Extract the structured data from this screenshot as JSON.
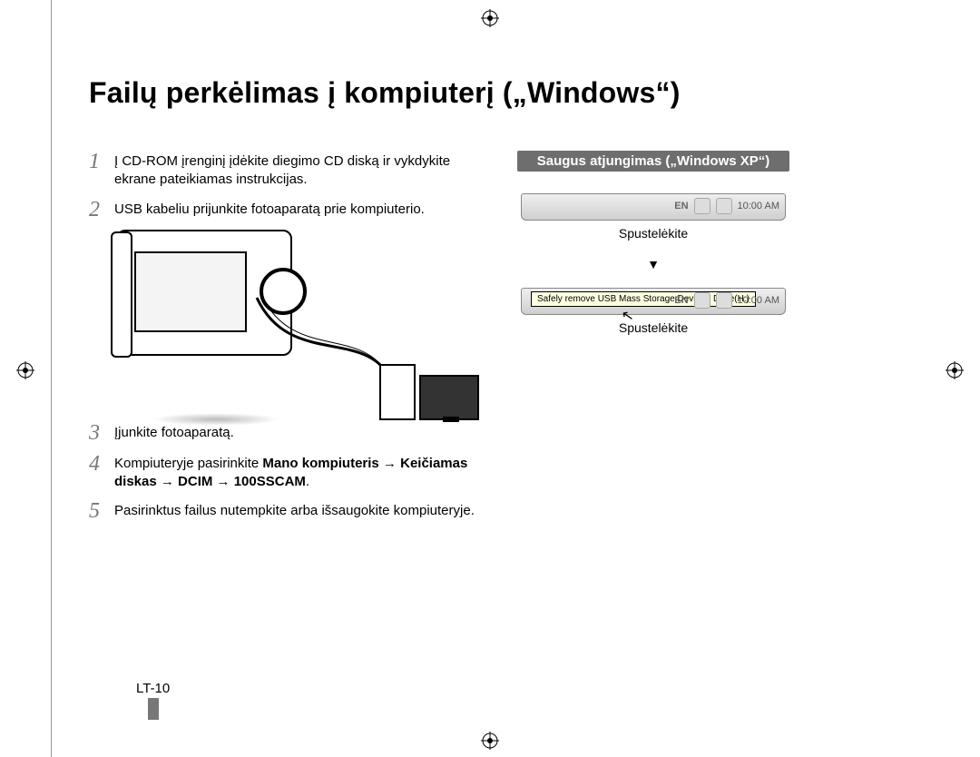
{
  "title": "Failų perkėlimas į kompiuterį („Windows“)",
  "steps": {
    "s1": {
      "n": "1",
      "t": "Į CD-ROM įrenginį įdėkite diegimo CD diską ir vykdykite ekrane pateikiamas instrukcijas."
    },
    "s2": {
      "n": "2",
      "t": "USB kabeliu prijunkite fotoaparatą prie kompiuterio."
    },
    "s3": {
      "n": "3",
      "t": "Įjunkite fotoaparatą."
    },
    "s4": {
      "n": "4",
      "pre": "Kompiuteryje pasirinkite ",
      "b1": "Mano kompiuteris",
      "arrow": " → ",
      "b2": "Keičiamas diskas",
      "b3": "DCIM",
      "b4": "100SSCAM",
      "dot": "."
    },
    "s5": {
      "n": "5",
      "t": "Pasirinktus failus nutempkite arba išsaugokite kompiuteryje."
    }
  },
  "right": {
    "header": "Saugus atjungimas („Windows XP“)",
    "click": "Spustelėkite",
    "down_arrow": "▼",
    "tooltip": "Safely remove USB Mass Storage Device - Drive(H:)",
    "en": "EN",
    "clock": "10:00 AM"
  },
  "page_num": "LT-10"
}
